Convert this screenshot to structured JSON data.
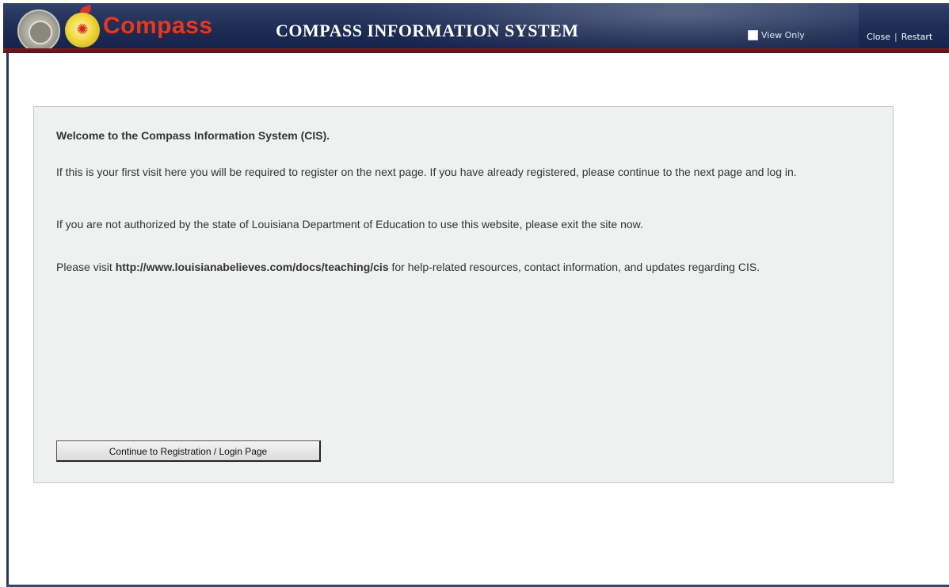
{
  "header": {
    "brand": "Compass",
    "title": "COMPASS INFORMATION SYSTEM",
    "view_only_label": "View Only",
    "links": {
      "close": "Close",
      "separator": "|",
      "restart": "Restart"
    },
    "icons": {
      "seal": "louisiana-seal-icon",
      "logo": "compass-apple-icon"
    }
  },
  "panel": {
    "welcome": "Welcome to the Compass Information System (CIS).",
    "para1": "If this is your first visit here you will be required to register on the next page. If you have already registered, please continue to the next page and log in.",
    "para2": "If you are not authorized by the state of Louisiana Department of Education to use this website, please exit the site now.",
    "para3_prefix": "Please visit ",
    "para3_link": "http://www.louisianabelieves.com/docs/teaching/cis",
    "para3_suffix": " for help-related resources, contact information, and updates regarding CIS.",
    "continue_button": "Continue to Registration / Login Page"
  },
  "colors": {
    "header_bg": "#1d2c55",
    "header_accent": "#7a1b24",
    "brand_red": "#e23a22",
    "panel_bg": "#eef1f0"
  }
}
